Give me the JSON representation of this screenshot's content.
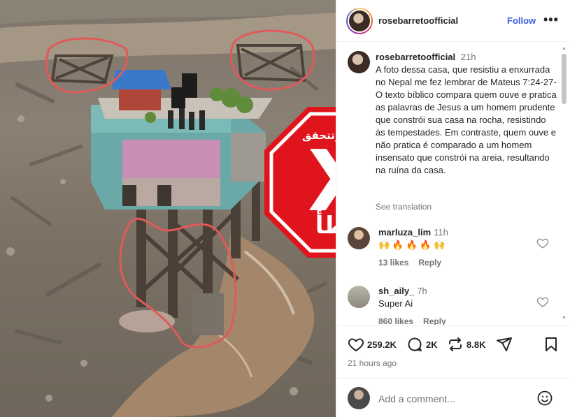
{
  "post": {
    "stamp": {
      "hashtag": "#النهار_تتحقق",
      "mark": "X",
      "verdict": "خطأ",
      "color": "#e0141c"
    }
  },
  "header": {
    "username": "rosebarretoofficial",
    "follow_label": "Follow",
    "more_label": "•••"
  },
  "caption": {
    "username": "rosebarretoofficial",
    "time": "21h",
    "text": "A foto dessa casa, que resistiu a enxurrada no Nepal me fez lembrar de Mateus 7:24-27- O texto bíblico compara quem ouve e pratica as palavras de Jesus a um homem prudente que constrói sua casa na rocha, resistindo às tempestades. Em contraste, quem ouve e não pratica é comparado a um homem insensato que constrói na areia, resultando na ruína da casa.",
    "translation_label": "See translation"
  },
  "comments": [
    {
      "username": "marluza_lim",
      "time": "11h",
      "text": "🙌 🔥 🔥 🔥 🙌",
      "likes": "13 likes",
      "reply": "Reply"
    },
    {
      "username": "sh_aily_",
      "time": "7h",
      "text": "Super Ai",
      "likes": "860 likes",
      "reply": "Reply"
    }
  ],
  "actions": {
    "likes": "259.2K",
    "comments": "2K",
    "reposts": "8.8K",
    "posted": "21 hours ago"
  },
  "add_comment": {
    "placeholder": "Add a comment..."
  },
  "colors": {
    "accent": "#3b5bdb",
    "stamp_red": "#e0141c",
    "annotation_red": "#e05a5a"
  }
}
